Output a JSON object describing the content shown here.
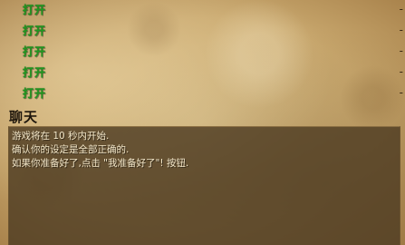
{
  "slots": {
    "rows": [
      {
        "open_label": "打开",
        "dash": "-"
      },
      {
        "open_label": "打开",
        "dash": "-"
      },
      {
        "open_label": "打开",
        "dash": "-"
      },
      {
        "open_label": "打开",
        "dash": "-"
      },
      {
        "open_label": "打开",
        "dash": "-"
      }
    ]
  },
  "chat": {
    "title": "聊天",
    "messages": [
      "游戏将在 10 秒内开始.",
      "确认你的设定是全部正确的.",
      "如果你准备好了,点击 \"我准备好了\"! 按钮."
    ]
  },
  "colors": {
    "open_label": "#1f9a1f",
    "chat_bg": "#4e3c22",
    "chat_text": "#f2e6c8"
  }
}
